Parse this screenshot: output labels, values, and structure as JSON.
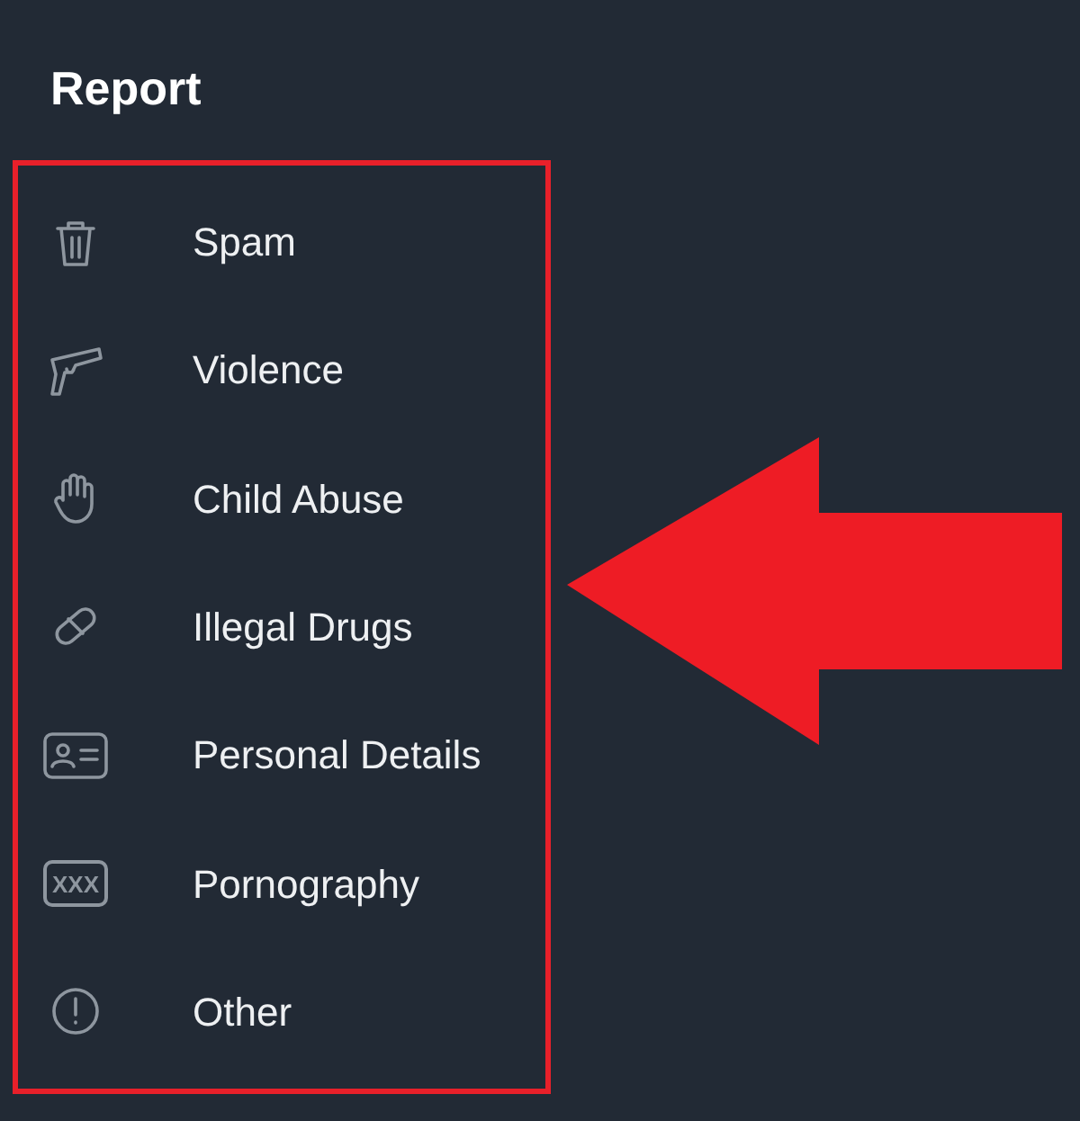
{
  "title": "Report",
  "items": [
    {
      "kind": "trash",
      "label": "Spam"
    },
    {
      "kind": "gun",
      "label": "Violence"
    },
    {
      "kind": "hand",
      "label": "Child Abuse"
    },
    {
      "kind": "pill",
      "label": "Illegal Drugs"
    },
    {
      "kind": "id-card",
      "label": "Personal Details"
    },
    {
      "kind": "xxx",
      "label": "Pornography",
      "icon_text": "XXX"
    },
    {
      "kind": "alert",
      "label": "Other"
    }
  ]
}
